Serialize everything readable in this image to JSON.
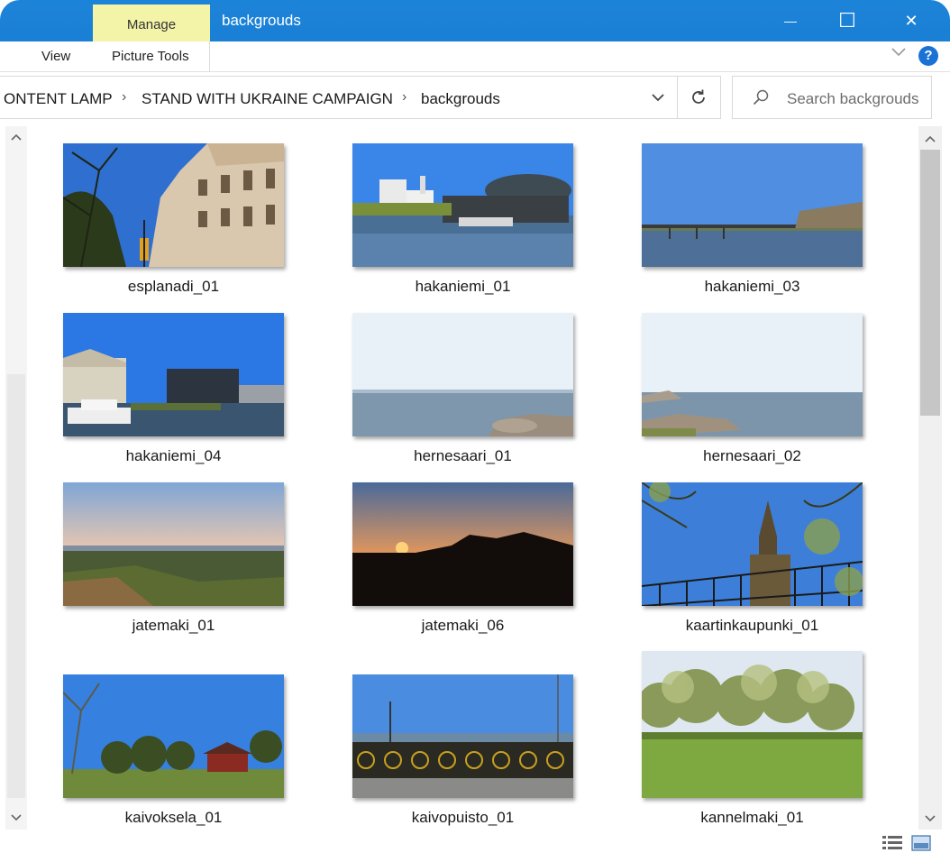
{
  "window": {
    "title": "backgrouds",
    "context_tab": "Manage",
    "minimize_glyph": "—",
    "maximize_glyph": "☐",
    "close_glyph": "✕"
  },
  "ribbon": {
    "tabs": [
      "View",
      "Picture Tools"
    ],
    "help_glyph": "?"
  },
  "address": {
    "breadcrumbs": [
      "ONTENT LAMP",
      "STAND WITH UKRAINE CAMPAIGN",
      "backgrouds"
    ],
    "separator": "›"
  },
  "search": {
    "placeholder": "Search backgrouds"
  },
  "files": [
    {
      "name": "esplanadi_01",
      "scene": "building"
    },
    {
      "name": "hakaniemi_01",
      "scene": "harbor"
    },
    {
      "name": "hakaniemi_03",
      "scene": "bridge"
    },
    {
      "name": "hakaniemi_04",
      "scene": "boats"
    },
    {
      "name": "hernesaari_01",
      "scene": "sea"
    },
    {
      "name": "hernesaari_02",
      "scene": "sea-rocks"
    },
    {
      "name": "jatemaki_01",
      "scene": "dusk"
    },
    {
      "name": "jatemaki_06",
      "scene": "sunset"
    },
    {
      "name": "kaartinkaupunki_01",
      "scene": "church"
    },
    {
      "name": "kaivoksela_01",
      "scene": "field"
    },
    {
      "name": "kaivopuisto_01",
      "scene": "bikes"
    },
    {
      "name": "kannelmaki_01",
      "scene": "park"
    }
  ],
  "colors": {
    "titlebar": "#1a7fd5",
    "manage_tab": "#f4f4a8",
    "help": "#1a73d4"
  }
}
